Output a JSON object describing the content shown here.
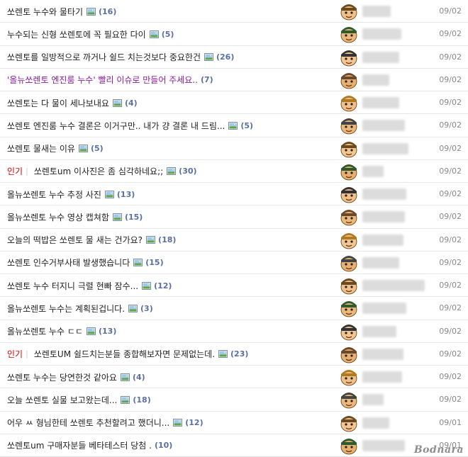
{
  "rows": [
    {
      "badge": "",
      "title": "쏘렌토 누수와 물타기",
      "count": "(16)",
      "date": "09/02",
      "purple": false
    },
    {
      "badge": "",
      "title": "누수되는 신형 쏘렌토에 꼭 필요한 다이",
      "count": "(5)",
      "date": "09/02",
      "purple": false
    },
    {
      "badge": "",
      "title": "쏘렌토를 일방적으로 까거나 쉴드 치는것보다 중요한건",
      "count": "(26)",
      "date": "09/02",
      "purple": false
    },
    {
      "badge": "",
      "title": "'올뉴쏘렌토 엔진룸 누수' 빨리 이슈로 만들어 주세요..",
      "count": "(7)",
      "date": "09/02",
      "purple": true,
      "no_icon": true
    },
    {
      "badge": "",
      "title": "쏘렌토는 다 물이 세나보내요",
      "count": "(4)",
      "date": "09/02",
      "purple": false
    },
    {
      "badge": "",
      "title": "쏘렌토 엔진룸 누수 결론은 이거구만.. 내가 걍 결론 내 드림...",
      "count": "(5)",
      "date": "09/02",
      "purple": false
    },
    {
      "badge": "",
      "title": "쏘렌토 물새는 이유",
      "count": "(5)",
      "date": "09/02",
      "purple": false
    },
    {
      "badge": "인기",
      "title": "쏘렌토um 이사진은 좀 심각하네요;;",
      "count": "(30)",
      "date": "09/02",
      "purple": false
    },
    {
      "badge": "",
      "title": "올뉴쏘렌토 누수 추정 사진",
      "count": "(13)",
      "date": "09/02",
      "purple": false
    },
    {
      "badge": "",
      "title": "올뉴쏘렌토 누수 영상 캡쳐함",
      "count": "(15)",
      "date": "09/02",
      "purple": false
    },
    {
      "badge": "",
      "title": "오늘의 떡밥은 쏘렌토 물 새는 건가요?",
      "count": "(18)",
      "date": "09/02",
      "purple": false
    },
    {
      "badge": "",
      "title": "쏘렌토 인수거부사태 발생했습니다",
      "count": "(15)",
      "date": "09/02",
      "purple": false
    },
    {
      "badge": "",
      "title": "쏘렌토 누수 터지니 극렬 현빠 잠수...",
      "count": "(12)",
      "date": "09/02",
      "purple": false
    },
    {
      "badge": "",
      "title": "올뉴쏘렌토 누수는 계획된겁니다.",
      "count": "(3)",
      "date": "09/02",
      "purple": false
    },
    {
      "badge": "",
      "title": "올뉴쏘렌토 누수 ㄷㄷ",
      "count": "(13)",
      "date": "09/02",
      "purple": false
    },
    {
      "badge": "인기",
      "title": "쏘렌토UM 쉴드치는분들 종합해보자면 문제없는데.",
      "count": "(23)",
      "date": "09/02",
      "purple": false
    },
    {
      "badge": "",
      "title": "쏘렌토 누수는 당연한것 같아요",
      "count": "(4)",
      "date": "09/02",
      "purple": false
    },
    {
      "badge": "",
      "title": "오늘 쏘렌토 실물 보고왔는데...",
      "count": "(18)",
      "date": "09/02",
      "purple": false
    },
    {
      "badge": "",
      "title": "어우 ㅆ 형님한테 쏘렌토 추천할려고 했더니...",
      "count": "(12)",
      "date": "09/01",
      "purple": false
    },
    {
      "badge": "",
      "title": "쏘렌토um 구매자분들 베타테스터 당첨 .",
      "count": "(10)",
      "date": "09/01",
      "purple": false,
      "no_icon": true
    }
  ],
  "watermark": "Bodnara",
  "colors": {
    "badge": "#e00000",
    "count": "#5a6fa8",
    "visited": "#8a1a9a",
    "date": "#888888"
  }
}
